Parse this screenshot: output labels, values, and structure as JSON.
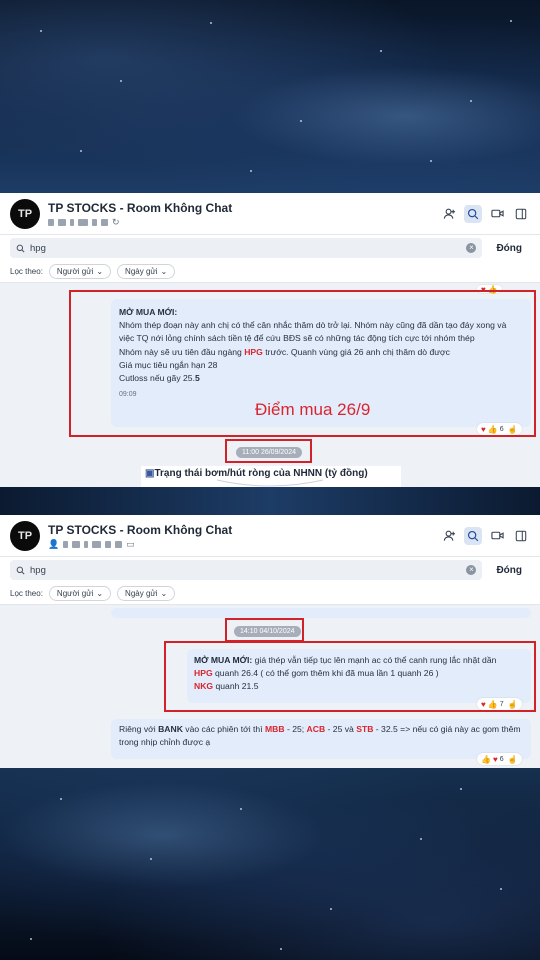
{
  "header": {
    "room_title": "TP STOCKS - Room Không Chat",
    "avatar_text": "TP"
  },
  "search": {
    "query": "hpg",
    "close_label": "Đóng"
  },
  "filter": {
    "label": "Lọc theo:",
    "sender_chip": "Người gửi",
    "date_chip": "Ngày gửi"
  },
  "panel1": {
    "message": {
      "heading": "MỞ MUA MỚI:",
      "line1": "Nhóm thép đoạn này anh chị có thể cân nhắc thăm dò trở lại. Nhóm này cũng đã dần tạo đáy xong  và việc TQ nới lỏng chính sách tiền tệ để cứu BĐS sẽ có những tác động tích cực tới nhóm thép",
      "line2_before": "Nhóm này sẽ ưu tiên đầu ngàng ",
      "line2_ticker": "HPG",
      "line2_after": " trước. Quanh vùng giá 26 anh chị thăm dò được",
      "line3": "Giá mục tiêu ngắn hạn 28",
      "line4_before": "Cutloss nếu gãy 25.",
      "line4_bold": "5",
      "time": "09:09",
      "reaction_count": "6"
    },
    "overlay_note": "Điểm mua 26/9",
    "date_pill": "11:00 26/09/2024",
    "stats_card": "Trạng thái bơm/hút ròng của NHNN (tỷ đồng)"
  },
  "panel2": {
    "message1": {
      "heading": "MỞ MUA MỚI:",
      "line1": " giá thép vẫn tiếp tục lên mạnh ac có thể canh rung lắc nhặt dần",
      "line2_ticker": "HPG",
      "line2_after": " quanh 26.4 ( có thể gom thêm khi đã mua lần 1 quanh 26 )",
      "line3_ticker": "NKG",
      "line3_after": " quanh 21.5",
      "reaction_count": "7"
    },
    "message2": {
      "p1": "Riêng với ",
      "bank": "BANK",
      "p2": " vào các phiên tới thì ",
      "mbb": "MBB",
      "p3": " - 25; ",
      "acb": "ACB",
      "p4": " - 25 và  ",
      "stb": "STB",
      "p5": " - 32.5 => nếu có giá này ac gom thêm trong nhịp chỉnh được ạ",
      "reaction_count": "6"
    },
    "date_pill": "14:10 04/10/2024"
  },
  "colors": {
    "highlight_red": "#d8262f",
    "bubble_blue": "#e3ecfb",
    "panel_bg": "#eef1f6"
  },
  "icons": [
    "add-member-icon",
    "search-icon",
    "video-call-icon",
    "sidebar-toggle-icon",
    "clear-icon",
    "chevron-down-icon",
    "heart-icon",
    "thumbs-up-icon",
    "like-icon"
  ]
}
